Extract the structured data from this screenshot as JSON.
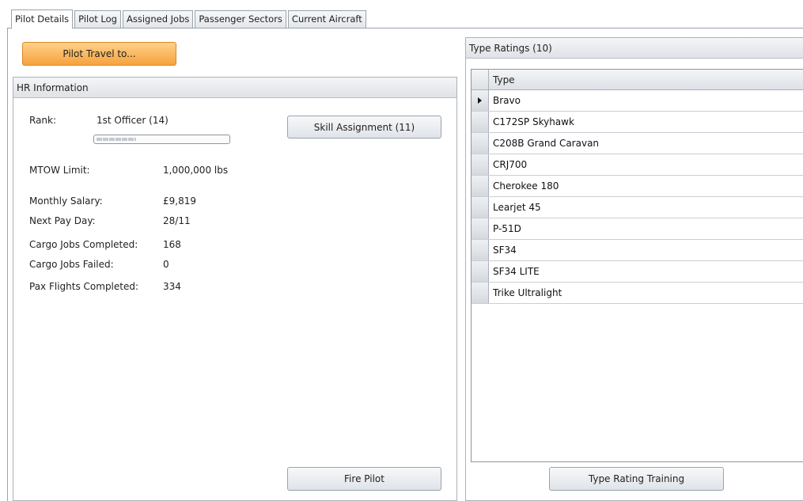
{
  "tabs": [
    {
      "label": "Pilot Details",
      "active": true
    },
    {
      "label": "Pilot Log",
      "active": false
    },
    {
      "label": "Assigned Jobs",
      "active": false
    },
    {
      "label": "Passenger Sectors",
      "active": false
    },
    {
      "label": "Current Aircraft",
      "active": false
    }
  ],
  "left": {
    "travel_button": "Pilot Travel to...",
    "hr_header": "HR Information",
    "rank_label": "Rank:",
    "rank_value": "1st Officer (14)",
    "rank_progress": 0.3,
    "skill_button": "Skill Assignment (11)",
    "mtow_label": "MTOW Limit:",
    "mtow_value": "1,000,000 lbs",
    "salary_label": "Monthly Salary:",
    "salary_value": "£9,819",
    "payday_label": "Next Pay Day:",
    "payday_value": "28/11",
    "cargo_completed_label": "Cargo Jobs Completed:",
    "cargo_completed_value": "168",
    "cargo_failed_label": "Cargo Jobs Failed:",
    "cargo_failed_value": "0",
    "pax_label": "Pax Flights Completed:",
    "pax_value": "334",
    "fire_button": "Fire Pilot"
  },
  "right": {
    "header": "Type Ratings (10)",
    "column_type": "Type",
    "rows": [
      {
        "label": "Bravo",
        "current": true
      },
      {
        "label": "C172SP Skyhawk",
        "current": false
      },
      {
        "label": "C208B Grand Caravan",
        "current": false
      },
      {
        "label": "CRJ700",
        "current": false
      },
      {
        "label": "Cherokee 180",
        "current": false
      },
      {
        "label": "Learjet 45",
        "current": false
      },
      {
        "label": "P-51D",
        "current": false
      },
      {
        "label": "SF34",
        "current": false
      },
      {
        "label": "SF34 LITE",
        "current": false
      },
      {
        "label": "Trike Ultralight",
        "current": false
      }
    ],
    "training_button": "Type Rating Training"
  },
  "colors": {
    "accent_button": "#f6a23c",
    "border": "#9aa3ad"
  }
}
